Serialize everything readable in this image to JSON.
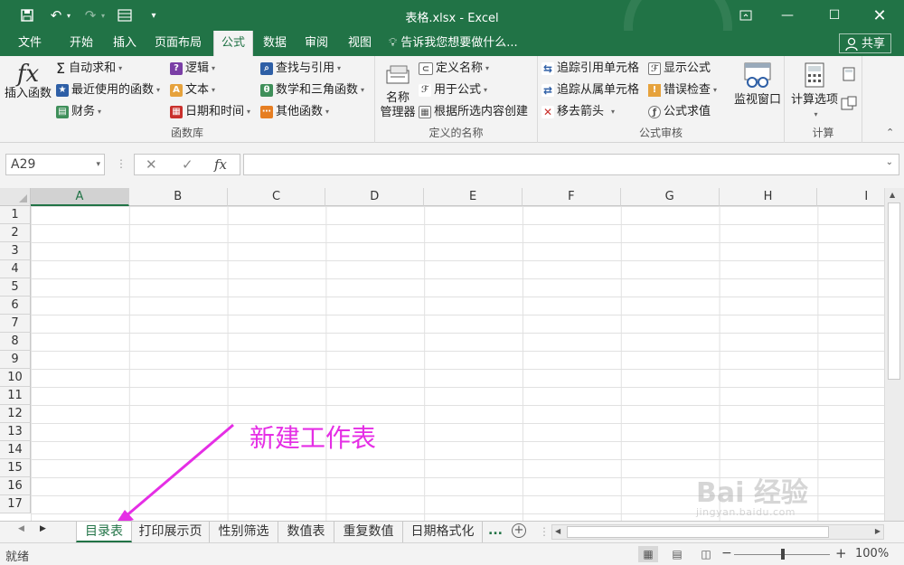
{
  "window": {
    "title": "表格.xlsx - Excel"
  },
  "tabs": [
    "文件",
    "开始",
    "插入",
    "页面布局",
    "公式",
    "数据",
    "审阅",
    "视图"
  ],
  "active_tab": "公式",
  "tell_me": "告诉我您想要做什么...",
  "share": "共享",
  "ribbon": {
    "function_library": {
      "label": "函数库",
      "insert_function": "插入函数",
      "fx_symbol": "fx",
      "autosum": "自动求和",
      "recent": "最近使用的函数",
      "financial": "财务",
      "logical": "逻辑",
      "text": "文本",
      "datetime": "日期和时间",
      "lookup": "查找与引用",
      "math": "数学和三角函数",
      "more": "其他函数"
    },
    "defined_names": {
      "label": "定义的名称",
      "name_manager_1": "名称",
      "name_manager_2": "管理器",
      "define_name": "定义名称",
      "use_in_formula": "用于公式",
      "create_from_selection": "根据所选内容创建"
    },
    "formula_auditing": {
      "label": "公式审核",
      "trace_precedents": "追踪引用单元格",
      "trace_dependents": "追踪从属单元格",
      "remove_arrows": "移去箭头",
      "show_formulas": "显示公式",
      "error_checking": "错误检查",
      "evaluate_formula": "公式求值",
      "watch_window": "监视窗口"
    },
    "calculation": {
      "label": "计算",
      "calc_options": "计算选项"
    }
  },
  "formula_bar": {
    "name_box": "A29",
    "fx": "fx",
    "value": ""
  },
  "columns": [
    "A",
    "B",
    "C",
    "D",
    "E",
    "F",
    "G",
    "H",
    "I"
  ],
  "selected_column": "A",
  "rows": [
    "1",
    "2",
    "3",
    "4",
    "5",
    "6",
    "7",
    "8",
    "9",
    "10",
    "11",
    "12",
    "13",
    "14",
    "15",
    "16",
    "17"
  ],
  "annotation": "新建工作表",
  "sheets": [
    "目录表",
    "打印展示页",
    "性别筛选",
    "数值表",
    "重复数值",
    "日期格式化"
  ],
  "active_sheet": "目录表",
  "more_sheets": "...",
  "status": {
    "ready": "就绪",
    "zoom": "100%"
  },
  "watermark": {
    "brand": "Bai 经验",
    "url": "jingyan.baidu.com"
  },
  "colors": {
    "accent": "#217346",
    "annotation": "#e52ee5"
  }
}
